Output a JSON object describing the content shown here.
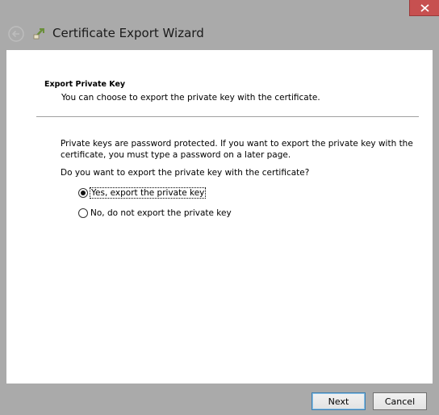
{
  "window": {
    "title": "Certificate Export Wizard"
  },
  "page": {
    "heading": "Export Private Key",
    "subheading": "You can choose to export the private key with the certificate.",
    "body_line1": "Private keys are password protected. If you want to export the private key with the",
    "body_line2": "certificate, you must type a password on a later page.",
    "question": "Do you want to export the private key with the certificate?"
  },
  "options": [
    {
      "label": "Yes, export the private key",
      "selected": true
    },
    {
      "label": "No, do not export the private key",
      "selected": false
    }
  ],
  "buttons": {
    "next_label": "Next",
    "cancel_label": "Cancel"
  },
  "icons": {
    "close": "close-icon",
    "back": "back-arrow-icon",
    "wizard": "certificate-icon"
  },
  "colors": {
    "close_button": "#c75050",
    "chrome": "#aaaaaa",
    "default_button_border": "#3c7fb1"
  }
}
